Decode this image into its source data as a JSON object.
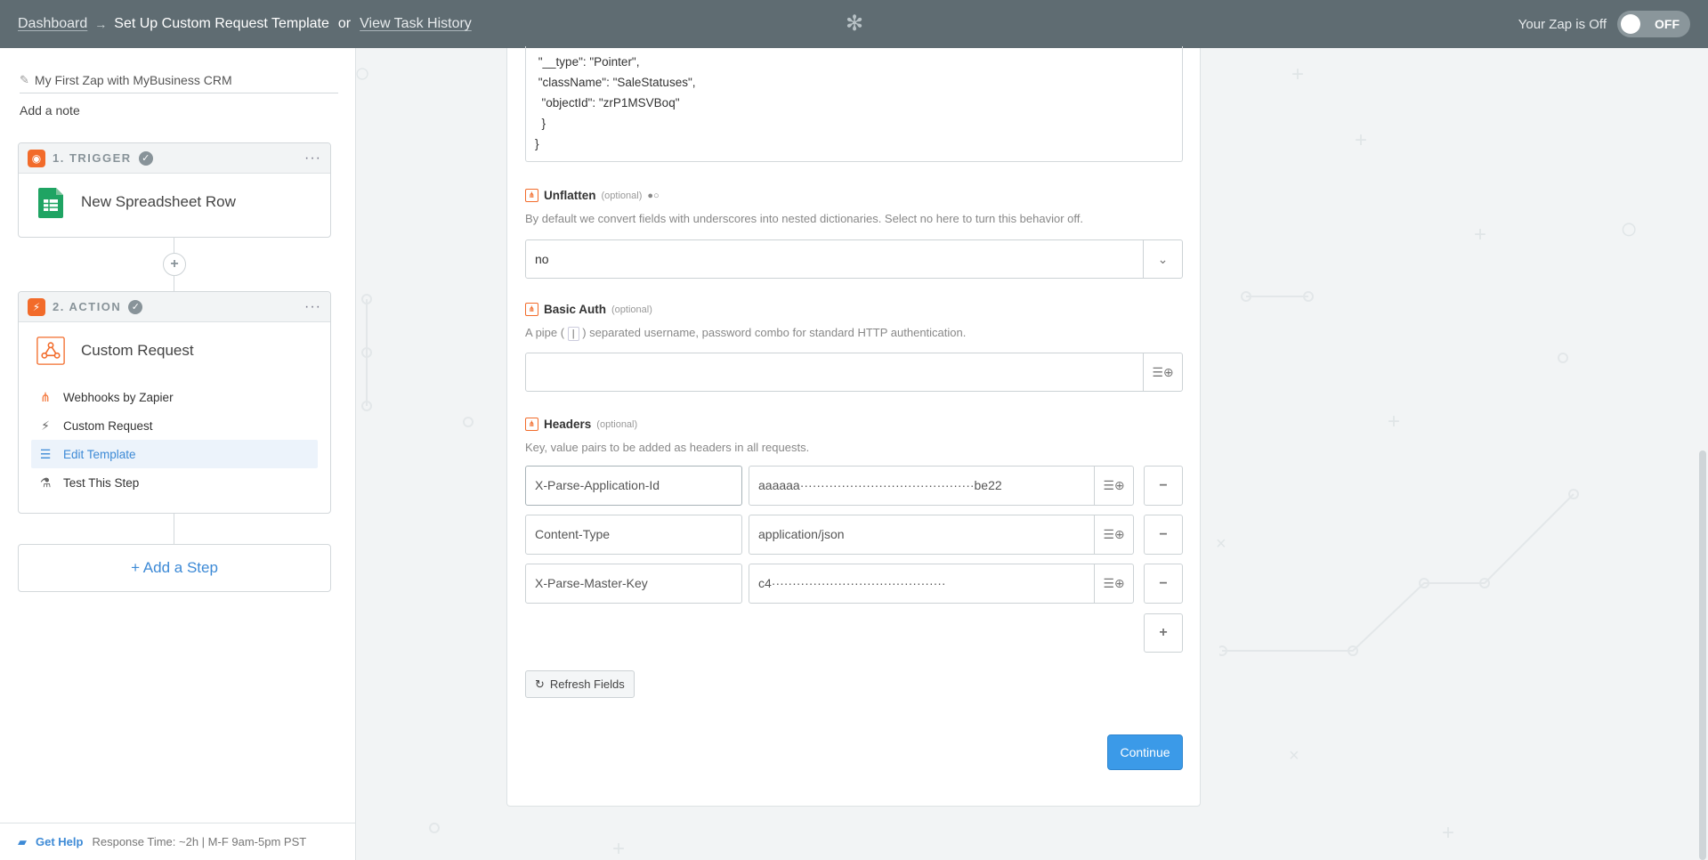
{
  "topbar": {
    "dashboard": "Dashboard",
    "arrow": "→",
    "current": "Set Up Custom Request Template",
    "or": "or",
    "history": "View Task History",
    "logo_icon": "zapier-asterisk-icon",
    "zap_status": "Your Zap is Off",
    "toggle_label": "OFF"
  },
  "sidebar": {
    "zap_name": "My First Zap with MyBusiness CRM",
    "add_note": "Add a note",
    "trigger": {
      "title": "1. TRIGGER",
      "name": "New Spreadsheet Row",
      "more": "···"
    },
    "action": {
      "title": "2. ACTION",
      "name": "Custom Request",
      "more": "···",
      "items": [
        {
          "label": "Webhooks by Zapier",
          "icon": "webhook-icon"
        },
        {
          "label": "Custom Request",
          "icon": "bolt-icon"
        },
        {
          "label": "Edit Template",
          "icon": "lines-icon"
        },
        {
          "label": "Test This Step",
          "icon": "flask-icon"
        }
      ]
    },
    "add_step": "+ Add a Step",
    "help": {
      "link": "Get Help",
      "meta": "Response Time: ~2h | M-F 9am-5pm PST"
    }
  },
  "main": {
    "json_text": " \"__type\": \"Pointer\",\n \"className\": \"SaleStatuses\",\n  \"objectId\": \"zrP1MSVBoq\"\n  }\n}",
    "unflatten": {
      "label": "Unflatten",
      "optional": "(optional)",
      "help": "By default we convert fields with underscores into nested dictionaries. Select no here to turn this behavior off.",
      "value": "no"
    },
    "basic_auth": {
      "label": "Basic Auth",
      "optional": "(optional)",
      "help_before": "A pipe (",
      "pipe": "|",
      "help_after": ") separated username, password combo for standard HTTP authentication.",
      "value": ""
    },
    "headers": {
      "label": "Headers",
      "optional": "(optional)",
      "help": "Key, value pairs to be added as headers in all requests.",
      "rows": [
        {
          "key": "X-Parse-Application-Id",
          "value": "aaaaaa··········································be22"
        },
        {
          "key": "Content-Type",
          "value": "application/json"
        },
        {
          "key": "X-Parse-Master-Key",
          "value": "c4··········································"
        }
      ]
    },
    "refresh": "Refresh Fields",
    "continue": "Continue"
  }
}
